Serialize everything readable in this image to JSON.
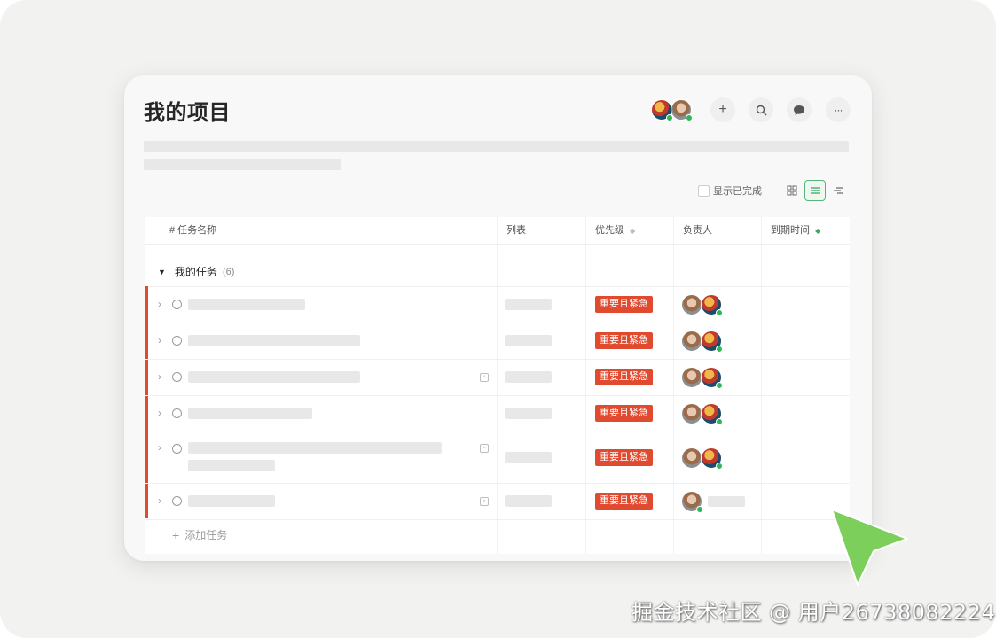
{
  "project": {
    "title": "我的项目"
  },
  "toolbar": {
    "add_icon": "plus-icon",
    "search_icon": "search-icon",
    "comment_icon": "comment-icon",
    "more_icon": "more-icon"
  },
  "view": {
    "show_completed_label": "显示已完成",
    "modes": [
      "grid-view-icon",
      "list-view-icon",
      "gantt-view-icon"
    ],
    "active_mode": "list"
  },
  "table": {
    "headers": {
      "task_name": "# 任务名称",
      "list": "列表",
      "priority": "优先级",
      "assignee": "负责人",
      "due_date": "到期时间"
    },
    "group": {
      "label": "我的任务",
      "count": "(6)"
    },
    "rows": [
      {
        "priority": "重要且紧急",
        "assignees": 2
      },
      {
        "priority": "重要且紧急",
        "assignees": 2
      },
      {
        "priority": "重要且紧急",
        "assignees": 2
      },
      {
        "priority": "重要且紧急",
        "assignees": 2
      },
      {
        "priority": "重要且紧急",
        "assignees": 2
      },
      {
        "priority": "重要且紧急",
        "assignees": 1
      }
    ],
    "add_task_label": "添加任务"
  },
  "colors": {
    "accent_red": "#e04a2f",
    "active_green": "#56b67a",
    "cursor_green": "#7ccf5a"
  },
  "watermark": "掘金技术社区 @ 用户26738082224"
}
